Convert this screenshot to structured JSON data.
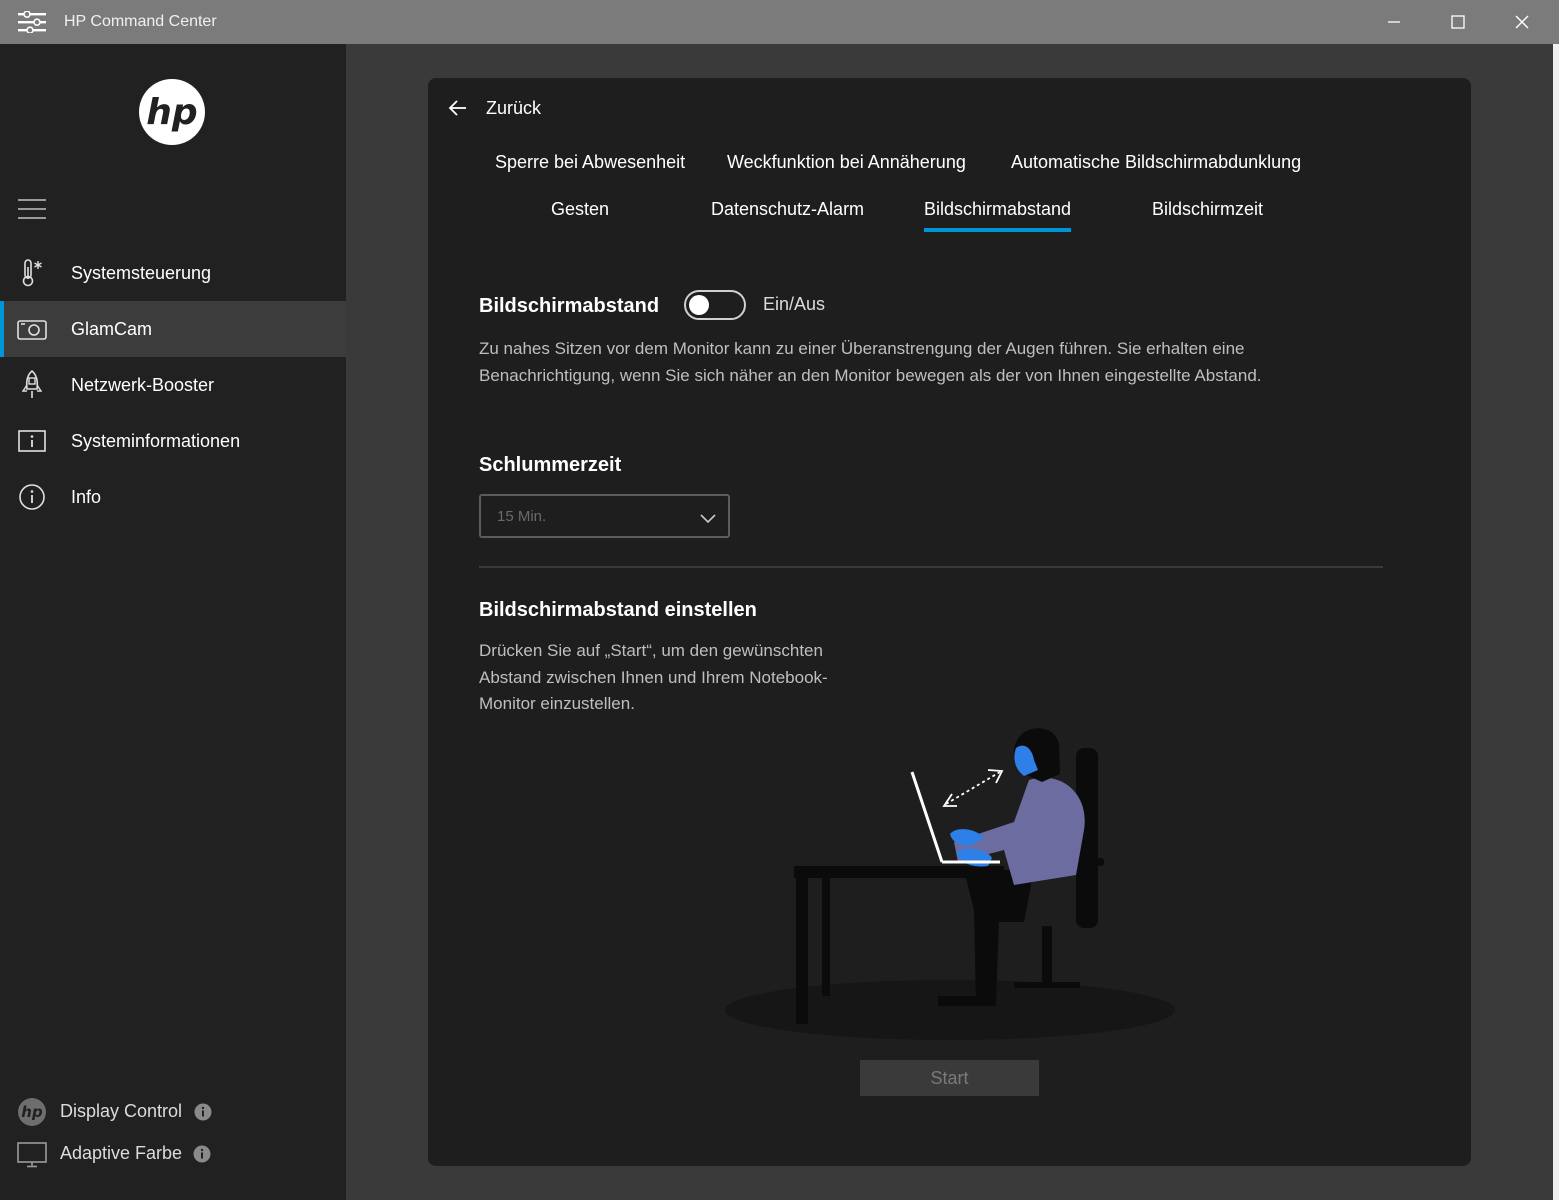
{
  "window": {
    "title": "HP Command Center",
    "controls": [
      "minimize-icon",
      "maximize-icon",
      "close-icon"
    ]
  },
  "sidebar": {
    "logo_icon": "hp-logo-icon",
    "menu_icon": "hamburger-icon",
    "items": [
      {
        "label": "Systemsteuerung",
        "icon": "thermometer-icon",
        "active": false
      },
      {
        "label": "GlamCam",
        "icon": "camera-icon",
        "active": true
      },
      {
        "label": "Netzwerk-Booster",
        "icon": "rocket-icon",
        "active": false
      },
      {
        "label": "Systeminformationen",
        "icon": "system-info-icon",
        "active": false
      },
      {
        "label": "Info",
        "icon": "info-circle-icon",
        "active": false
      }
    ],
    "bottom_items": [
      {
        "label": "Display Control",
        "icon": "hp-logo-icon",
        "info_icon": "info-badge-icon"
      },
      {
        "label": "Adaptive Farbe",
        "icon": "monitor-icon",
        "info_icon": "info-badge-icon"
      }
    ]
  },
  "main": {
    "back_label": "Zurück",
    "tabs": [
      {
        "label": "Sperre bei Abwesenheit",
        "active": false
      },
      {
        "label": "Weckfunktion bei Annäherung",
        "active": false
      },
      {
        "label": "Automatische Bildschirmabdunklung",
        "active": false
      },
      {
        "label": "Gesten",
        "active": false
      },
      {
        "label": "Datenschutz-Alarm",
        "active": false
      },
      {
        "label": "Bildschirmabstand",
        "active": true
      },
      {
        "label": "Bildschirmzeit",
        "active": false
      }
    ],
    "distance": {
      "title": "Bildschirmabstand",
      "toggle_label": "Ein/Aus",
      "toggle_on": false,
      "description": "Zu nahes Sitzen vor dem Monitor kann zu einer Überanstrengung der Augen führen. Sie erhalten eine Benachrichtigung, wenn Sie sich näher an den Monitor bewegen als der von Ihnen eingestellte Abstand."
    },
    "snooze": {
      "title": "Schlummerzeit",
      "selected": "15 Min."
    },
    "adjust": {
      "title": "Bildschirmabstand einstellen",
      "description": "Drücken Sie auf „Start“, um den gewünschten Abstand zwischen Ihnen und Ihrem Notebook-Monitor einzustellen.",
      "start_label": "Start"
    }
  },
  "colors": {
    "accent": "#0096d6",
    "titlebar": "#7b7b7b",
    "sidebar": "#212121",
    "panel": "#1e1e1e",
    "background": "#3a3a3a"
  }
}
